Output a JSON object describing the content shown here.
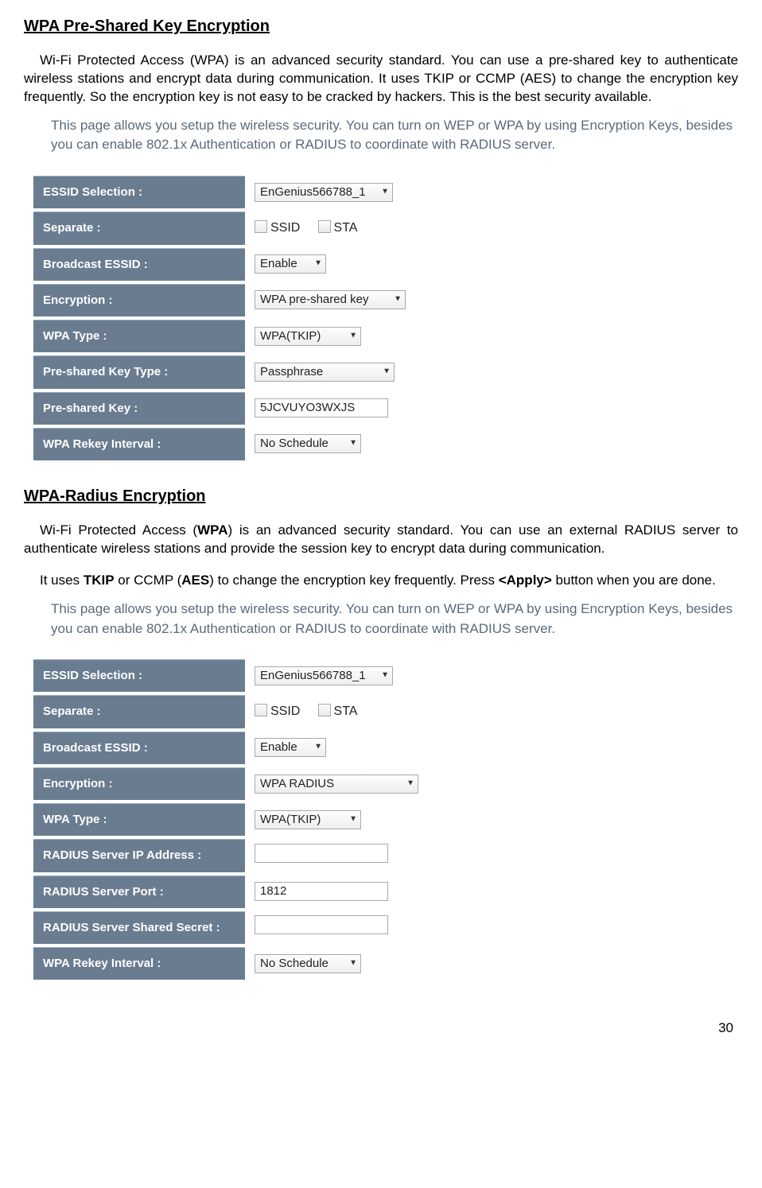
{
  "section1": {
    "heading": "WPA Pre-Shared Key Encryption",
    "para": "Wi-Fi Protected Access (WPA) is an advanced security standard. You can use a pre-shared key to authenticate wireless stations and encrypt data during communication. It uses TKIP or CCMP (AES) to change the encryption key frequently. So the encryption key is not easy to be cracked by hackers. This is the best security available.",
    "intro": "This page allows you setup the wireless security. You can turn on WEP or WPA by using Encryption Keys, besides you can enable 802.1x Authentication or RADIUS to coordinate with RADIUS server.",
    "rows": {
      "essid_label": "ESSID Selection :",
      "essid_value": "EnGenius566788_1",
      "separate_label": "Separate :",
      "separate_opt1": "SSID",
      "separate_opt2": "STA",
      "broadcast_label": "Broadcast ESSID :",
      "broadcast_value": "Enable",
      "encryption_label": "Encryption :",
      "encryption_value": "WPA pre-shared key",
      "wpatype_label": "WPA Type :",
      "wpatype_value": "WPA(TKIP)",
      "pskt_label": "Pre-shared Key Type :",
      "pskt_value": "Passphrase",
      "psk_label": "Pre-shared Key :",
      "psk_value": "5JCVUYO3WXJS",
      "rekey_label": "WPA Rekey Interval :",
      "rekey_value": "No Schedule"
    }
  },
  "section2": {
    "heading": "WPA-Radius Encryption",
    "para1_pre": "Wi-Fi Protected Access (",
    "para1_b1": "WPA",
    "para1_mid": ") is an advanced security standard. You can use an external RADIUS server to authenticate wireless stations and provide the session key to encrypt data during communication.",
    "para2_pre": "It uses ",
    "para2_b1": "TKIP",
    "para2_mid1": " or CCMP (",
    "para2_b2": "AES",
    "para2_mid2": ") to change the encryption key frequently. Press ",
    "para2_b3": "<Apply>",
    "para2_end": " button when you are done.",
    "intro": "This page allows you setup the wireless security. You can turn on WEP or WPA by using Encryption Keys, besides you can enable 802.1x Authentication or RADIUS to coordinate with RADIUS server.",
    "rows": {
      "essid_label": "ESSID Selection :",
      "essid_value": "EnGenius566788_1",
      "separate_label": "Separate :",
      "separate_opt1": "SSID",
      "separate_opt2": "STA",
      "broadcast_label": "Broadcast ESSID :",
      "broadcast_value": "Enable",
      "encryption_label": "Encryption :",
      "encryption_value": "WPA RADIUS",
      "wpatype_label": "WPA Type :",
      "wpatype_value": "WPA(TKIP)",
      "rip_label": "RADIUS Server IP Address :",
      "rip_value": "",
      "rport_label": "RADIUS Server Port :",
      "rport_value": "1812",
      "rsecret_label": "RADIUS Server Shared Secret :",
      "rsecret_value": "",
      "rekey_label": "WPA Rekey Interval :",
      "rekey_value": "No Schedule"
    }
  },
  "page_number": "30"
}
